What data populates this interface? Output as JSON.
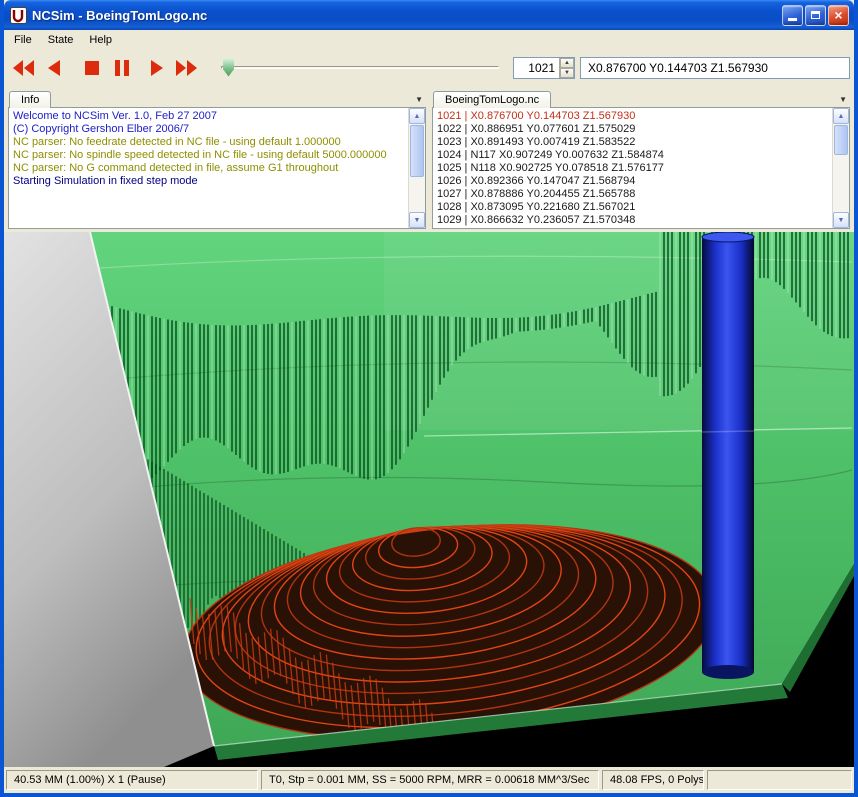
{
  "window": {
    "title": "NCSim - BoeingTomLogo.nc",
    "controls": [
      "minimize",
      "maximize",
      "close"
    ]
  },
  "menu": {
    "items": [
      {
        "label": "File"
      },
      {
        "label": "State"
      },
      {
        "label": "Help"
      }
    ]
  },
  "toolbar": {
    "playback_icons": [
      "rewind-icon",
      "step-back-icon",
      "stop-icon",
      "pause-icon",
      "play-icon",
      "fast-forward-icon"
    ],
    "position_value": "1021",
    "coordinate_readout": "X0.876700 Y0.144703 Z1.567930"
  },
  "info_panel": {
    "tab_label": "Info",
    "lines": [
      {
        "text": "Welcome to NCSim Ver. 1.0, Feb 27 2007",
        "type": "info"
      },
      {
        "text": "(C) Copyright Gershon Elber 2006/7",
        "type": "info"
      },
      {
        "text": "NC parser: No feedrate detected in NC file - using default 1.000000",
        "type": "warning"
      },
      {
        "text": "NC parser: No spindle speed detected in NC file - using default 5000.000000",
        "type": "warning"
      },
      {
        "text": "NC parser: No G command detected in file, assume G1 throughout",
        "type": "warning"
      },
      {
        "text": "Starting Simulation in fixed step mode",
        "type": "status"
      }
    ]
  },
  "nc_panel": {
    "tab_label": "BoeingTomLogo.nc",
    "lines": [
      {
        "text": "1021 | X0.876700 Y0.144703 Z1.567930",
        "current": true
      },
      {
        "text": "1022 | X0.886951 Y0.077601 Z1.575029",
        "current": false
      },
      {
        "text": "1023 | X0.891493 Y0.007419 Z1.583522",
        "current": false
      },
      {
        "text": "1024 | N117 X0.907249 Y0.007632 Z1.584874",
        "current": false
      },
      {
        "text": "1025 | N118 X0.902725 Y0.078518 Z1.576177",
        "current": false
      },
      {
        "text": "1026 | X0.892366 Y0.147047 Z1.568794",
        "current": false
      },
      {
        "text": "1027 | X0.878886 Y0.204455 Z1.565788",
        "current": false
      },
      {
        "text": "1028 | X0.873095 Y0.221680 Z1.567021",
        "current": false
      },
      {
        "text": "1029 | X0.866632 Y0.236057 Z1.570348",
        "current": false
      }
    ]
  },
  "status_bar": {
    "progress": "40.53 MM (1.00%) X 1 (Pause)",
    "machining": "T0, Stp = 0.001 MM, SS = 5000 RPM, MRR = 0.00618 MM^3/Sec",
    "performance": "48.08 FPS, 0 Polys",
    "extra": ""
  },
  "colors": {
    "titlebar_blue": "#0A50CC",
    "window_border": "#0A55D2",
    "chrome_bg": "#ECE9D8",
    "playback_red": "#DD2B0D",
    "stock_green": "#4CBE66",
    "toolpath_red": "#D03810",
    "tool_blue": "#1B2FC8",
    "current_line_red": "#C33018",
    "log_info_blue": "#2020C8",
    "log_warning_olive": "#8F8F00"
  }
}
